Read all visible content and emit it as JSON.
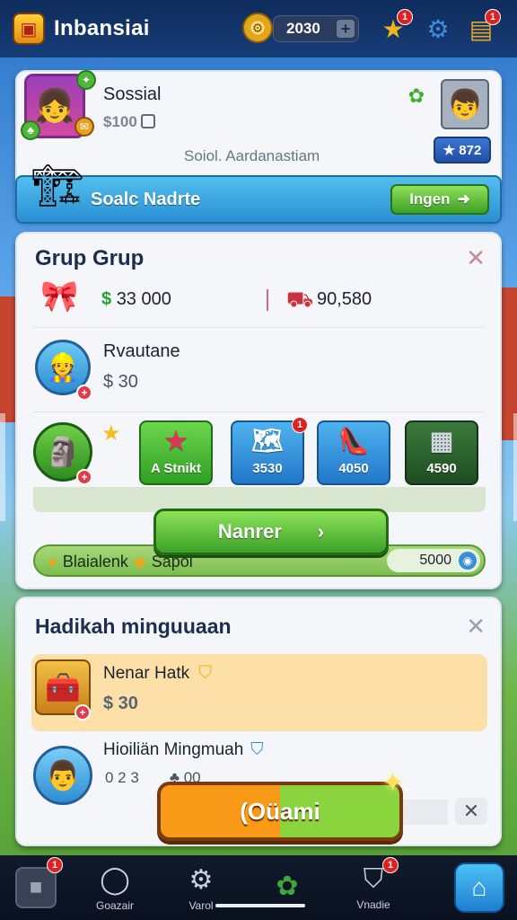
{
  "topbar": {
    "title": "Inbansiai",
    "coins": "2030",
    "coin_plus": "+",
    "star_badge": "1",
    "gift_badge": "1"
  },
  "profile": {
    "name": "Sossial",
    "coins": "$100",
    "subtitle": "Soiol. Aardanastiam",
    "rank": "★ 872"
  },
  "social_bar": {
    "title": "Soalc Nadrte",
    "button": "Ingen",
    "button_arrow": "➜"
  },
  "group": {
    "title": "Grup Grup",
    "close": "✕",
    "money_a": "33 000",
    "money_a_currency": "$",
    "money_b": "90,580",
    "member_name": "Rvautane",
    "member_price": "$ 30",
    "tiles": [
      {
        "label": "A Stnikt",
        "icon": "★"
      },
      {
        "label": "3530",
        "icon": "🗺"
      },
      {
        "label": "4050",
        "icon": "👠"
      },
      {
        "label": "4590",
        "icon": "▦"
      }
    ],
    "tile_badge": "1",
    "next_button": "Nanrer",
    "next_arrow": "›",
    "status_left": "Blaialenk",
    "status_left2": "Sapol",
    "status_right": "5000"
  },
  "rewards": {
    "title": "Hadikah minguuaan",
    "close": "✕",
    "item1_title": "Nenar Hatk",
    "item1_price": "$ 30",
    "item2_title": "Hioiliän Mingmuah",
    "item2_val_a": "0 2 3",
    "item2_val_b": "♣ 00",
    "primary_button": "(Oüami",
    "close_small": "✕"
  },
  "bottom_nav": {
    "items": [
      {
        "label": "",
        "badge": "1"
      },
      {
        "label": "Goazair"
      },
      {
        "label": "Varol"
      },
      {
        "label": ""
      },
      {
        "label": "Vnadie",
        "badge": "1"
      }
    ]
  }
}
